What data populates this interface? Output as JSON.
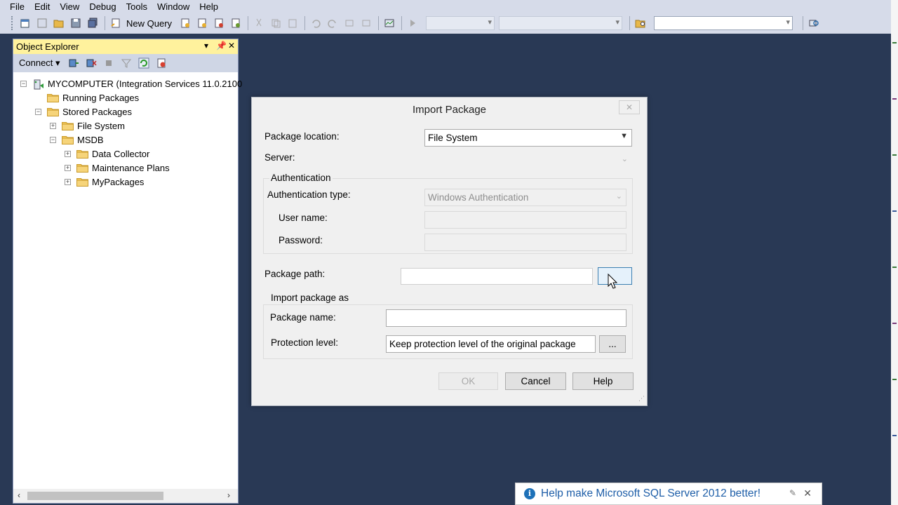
{
  "menu": [
    "File",
    "Edit",
    "View",
    "Debug",
    "Tools",
    "Window",
    "Help"
  ],
  "toolbar": {
    "new_query_label": "New Query"
  },
  "object_explorer": {
    "title": "Object Explorer",
    "connect_label": "Connect",
    "tree": [
      {
        "label": "MYCOMPUTER (Integration Services 11.0.2100",
        "level": 0,
        "state": "expanded",
        "icon": "server-icon"
      },
      {
        "label": "Running Packages",
        "level": 1,
        "state": "none",
        "icon": "folder-icon"
      },
      {
        "label": "Stored Packages",
        "level": 1,
        "state": "expanded",
        "icon": "folder-icon"
      },
      {
        "label": "File System",
        "level": 2,
        "state": "collapsed",
        "icon": "folder-icon"
      },
      {
        "label": "MSDB",
        "level": 2,
        "state": "expanded",
        "icon": "folder-icon"
      },
      {
        "label": "Data Collector",
        "level": 3,
        "state": "collapsed",
        "icon": "folder-icon"
      },
      {
        "label": "Maintenance Plans",
        "level": 3,
        "state": "collapsed",
        "icon": "folder-icon"
      },
      {
        "label": "MyPackages",
        "level": 3,
        "state": "collapsed",
        "icon": "folder-icon"
      }
    ]
  },
  "dialog": {
    "title": "Import Package",
    "package_location_label": "Package location:",
    "package_location_value": "File System",
    "server_label": "Server:",
    "server_value": "",
    "authentication_group": "Authentication",
    "auth_type_label": "Authentication type:",
    "auth_type_value": "Windows Authentication",
    "username_label": "User name:",
    "password_label": "Password:",
    "package_path_label": "Package path:",
    "package_path_value": "",
    "browse_label": "...",
    "import_as_group": "Import package as",
    "package_name_label": "Package name:",
    "package_name_value": "",
    "protection_label": "Protection level:",
    "protection_value": "Keep protection level of the original package",
    "protection_btn": "...",
    "ok": "OK",
    "cancel": "Cancel",
    "help": "Help"
  },
  "notification": {
    "text": "Help make Microsoft SQL Server 2012 better!"
  },
  "colors": {
    "workspace": "#293955",
    "oe_title": "#fff29d",
    "notification_text": "#1e5ea8"
  }
}
